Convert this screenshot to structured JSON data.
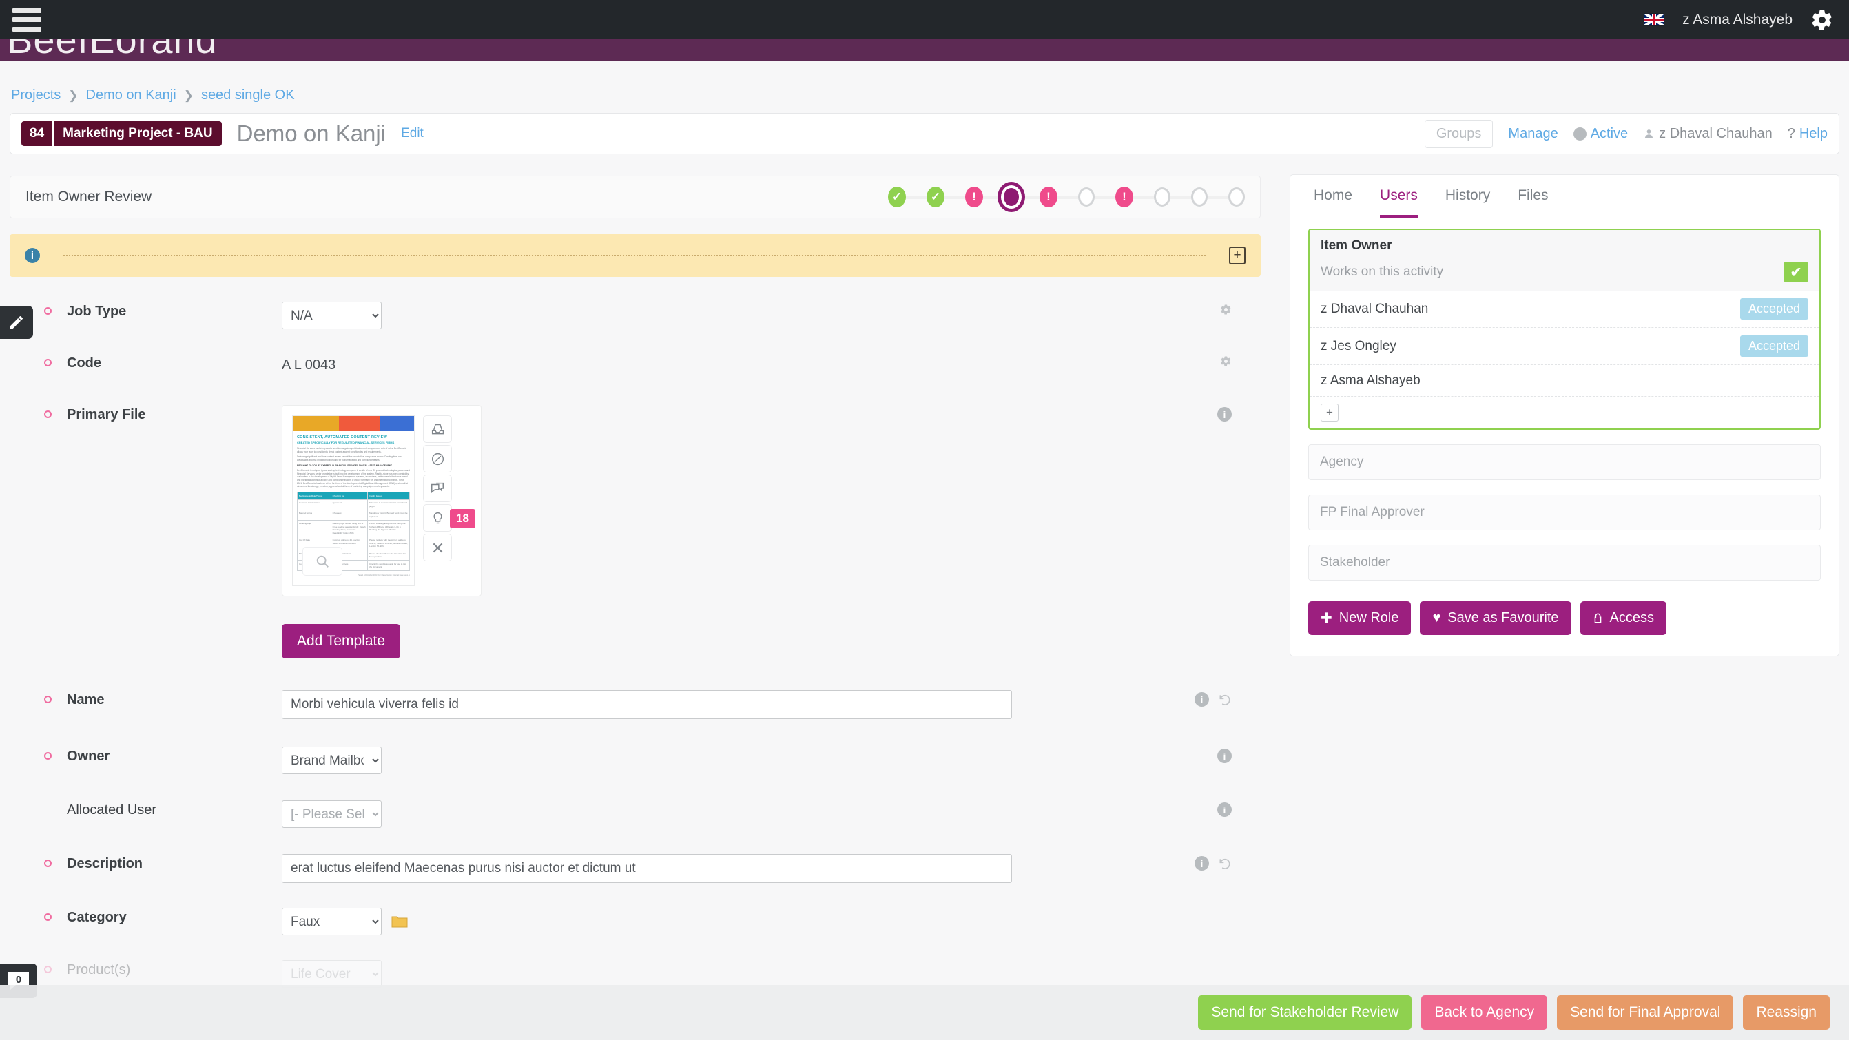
{
  "topbar": {
    "menu_icon": "hamburger-icon",
    "flag_icon": "uk-flag-icon",
    "user": "z Asma Alshayeb",
    "settings_icon": "gear-icon"
  },
  "brand": {
    "logo_text": "BeefEorand"
  },
  "breadcrumb": {
    "items": [
      {
        "label": "Projects"
      },
      {
        "label": "Demo on Kanji"
      },
      {
        "label": "seed single OK"
      }
    ],
    "separator": "❯"
  },
  "title_card": {
    "id": "84",
    "project_badge": "Marketing Project - BAU",
    "title": "Demo on Kanji",
    "edit_label": "Edit",
    "groups_label": "Groups",
    "manage_label": "Manage",
    "active_label": "Active",
    "owner_label": "z Dhaval Chauhan",
    "help_label": "Help",
    "help_prefix": "?"
  },
  "workflow": {
    "stage_label": "Item Owner Review",
    "steps": [
      {
        "state": "done",
        "glyph": "✓"
      },
      {
        "state": "done",
        "glyph": "✓"
      },
      {
        "state": "alert",
        "glyph": "!"
      },
      {
        "state": "current",
        "glyph": ""
      },
      {
        "state": "alert",
        "glyph": "!"
      },
      {
        "state": "empty",
        "glyph": ""
      },
      {
        "state": "alert",
        "glyph": "!"
      },
      {
        "state": "empty",
        "glyph": ""
      },
      {
        "state": "empty",
        "glyph": ""
      },
      {
        "state": "empty",
        "glyph": ""
      }
    ]
  },
  "alert_bar": {
    "info_glyph": "i",
    "text": "",
    "expand_icon": "plus-square-icon"
  },
  "form": {
    "job_type": {
      "label": "Job Type",
      "value": "N/A",
      "required": true
    },
    "code": {
      "label": "Code",
      "value": "A L 0043",
      "required": true
    },
    "primary_file": {
      "label": "Primary File",
      "required": true
    },
    "name": {
      "label": "Name",
      "value": "Morbi vehicula viverra felis id",
      "required": true
    },
    "owner": {
      "label": "Owner",
      "value": "Brand Mailbox",
      "required": true
    },
    "allocated_user": {
      "label": "Allocated User",
      "value": "[- Please Select -]",
      "required": false
    },
    "description": {
      "label": "Description",
      "value": "erat luctus eleifend Maecenas purus nisi auctor et dictum ut",
      "required": true
    },
    "category": {
      "label": "Category",
      "value": "Faux",
      "required": true
    },
    "products": {
      "label": "Product(s)",
      "value": "Life Cover",
      "required": true
    },
    "add_template_label": "Add Template"
  },
  "thumbnail": {
    "banner_colors": [
      "#e8a827",
      "#f05a3c",
      "#3b6fd4"
    ],
    "heading": "CONSISTENT, AUTOMATED CONTENT REVIEW",
    "subheading": "CREATED SPECIFICALLY FOR REGULATED FINANCIAL SERVICES FIRMS",
    "paragraphs": [
      "Financial Services marketing assets need to navigate sophistication and compounded sets of rules. BeefZomerio allows your team to consistently check content against specific rules and requirements.",
      "Delivering significant real-time content review capabilities prior to final compliance review. Creating time-cost advantages and risk mitigation opportunity for busy marketing and compliance teams.",
      "BROUGHT TO YOU BY EXPERTS IN FINANCIAL SERVICES DIGITAL ASSET MANAGEMENT",
      "BeefZomerio is not your typical start-up technology company. A wealth of over 20 years of technological process and Financial Services sector knowledge is built into the development of the system. Rest-to-niche has been created by our leaders in the development of Digital Asset Management systems, technicians, bettercares in the hands brand and marketing workflow archive and compliance system of choice for many UK and international brands. Since 2001, BeefZomerio has been at the forefront of the development of Digital Asset Management (DAM) systems that streamline the storage, creation, approval and delivery of marketing campaigns and key assets."
    ],
    "table_headers": [
      "BeefZomerio Rule Types",
      "Checking for",
      "Insight Issued"
    ],
    "table_rows": [
      [
        "Common Inaccuracies",
        "Typos / AI",
        "This word is too casual and is considered jargon"
      ],
      [
        "Banned words",
        "Cheapest",
        "Mandatory Insight: Banned word, must be replaced"
      ],
      [
        "Reading Age",
        "Reading Age Scored using one of three reading age standards: Flesch Reading Ease; Automatic Readability Index (ARI)",
        "Flesch Reading Easy 0-100 1 being the highest difficulty; ARI scale 6-14, 1 Reading the highest difficulty"
      ],
      [
        "Out Of Date",
        "Incorrect address: 44 Junction Street Shoreditch London",
        "Please replace with the current address: Unit 12, Guilford Wharve, Shoreton Road, London N1 9RG"
      ],
      [
        "Mandatory substantiation",
        "Environment hazard",
        "Please check evidence for this claim has been provided"
      ],
      [
        "Content Guidance",
        "Gift as incentives",
        "Check the word is suitable for use in this the document"
      ]
    ],
    "footer": "Page 1\n10 October 2023\nDoc Classification: Internal\nwww.demo.io",
    "magnify_icon": "magnifier-icon",
    "actions": [
      {
        "icon": "download-inbox-icon",
        "badge": null
      },
      {
        "icon": "leaf-badge-icon",
        "badge": null
      },
      {
        "icon": "comment-icon",
        "badge": null
      },
      {
        "icon": "lightbulb-icon",
        "badge": "18"
      },
      {
        "icon": "close-x-icon",
        "badge": null
      }
    ]
  },
  "sidebar": {
    "tabs": [
      {
        "label": "Home",
        "active": false
      },
      {
        "label": "Users",
        "active": true
      },
      {
        "label": "History",
        "active": false
      },
      {
        "label": "Files",
        "active": false
      }
    ],
    "item_owner": {
      "title": "Item Owner",
      "subtitle": "Works on this activity",
      "check_glyph": "✔",
      "users": [
        {
          "name": "z Dhaval Chauhan",
          "status": "Accepted"
        },
        {
          "name": "z Jes Ongley",
          "status": "Accepted"
        },
        {
          "name": "z Asma Alshayeb",
          "status": ""
        }
      ],
      "add_glyph": "+"
    },
    "empty_roles": [
      {
        "label": "Agency"
      },
      {
        "label": "FP Final Approver"
      },
      {
        "label": "Stakeholder"
      }
    ],
    "buttons": [
      {
        "label": "New Role",
        "icon": "plus-icon",
        "glyph": "✚"
      },
      {
        "label": "Save as Favourite",
        "icon": "heart-icon",
        "glyph": "♥"
      },
      {
        "label": "Access",
        "icon": "lock-icon",
        "glyph": "🔒"
      }
    ]
  },
  "left_tabs": [
    {
      "name": "edit-pencil-tab",
      "icon": "pencil-icon"
    },
    {
      "name": "comments-tab",
      "icon": "comment-bubble-icon",
      "count": "0"
    }
  ],
  "bottom_actions": [
    {
      "label": "Send for Stakeholder Review",
      "color": "#8fd14f"
    },
    {
      "label": "Back to Agency",
      "color": "#f0688f"
    },
    {
      "label": "Send for Final Approval",
      "color": "#e79a67"
    },
    {
      "label": "Reassign",
      "color": "#e79a67"
    }
  ]
}
